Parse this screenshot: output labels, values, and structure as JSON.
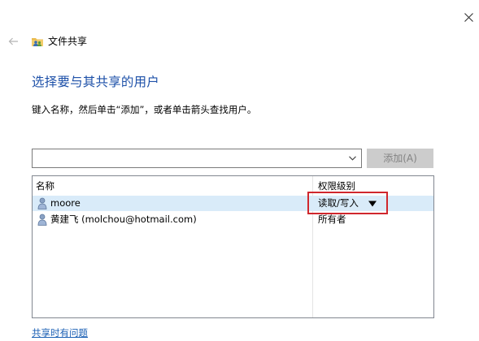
{
  "window": {
    "title": "文件共享"
  },
  "heading": "选择要与其共享的用户",
  "instruction": "键入名称，然后单击“添加”，或者单击箭头查找用户。",
  "input": {
    "value": "",
    "placeholder": ""
  },
  "add_button_label": "添加(A)",
  "table": {
    "columns": [
      "名称",
      "权限级别"
    ],
    "rows": [
      {
        "name": "moore",
        "permission": "读取/写入",
        "selected": true,
        "has_dropdown": true
      },
      {
        "name": "黄建飞 (molchou@hotmail.com)",
        "permission": "所有者",
        "selected": false,
        "has_dropdown": false
      }
    ]
  },
  "help_link": "共享时有问题",
  "colors": {
    "heading": "#1d50a8",
    "selected_row": "#d9ebf9",
    "highlight": "#d0272d",
    "link": "#1a5fb4",
    "disabled_button_bg": "#cccccc"
  },
  "icons": {
    "close": "close-icon",
    "back": "back-arrow-icon",
    "title": "file-sharing-icon",
    "combo": "chevron-down-icon",
    "user": "user-icon",
    "permission_dropdown": "caret-down-icon"
  }
}
